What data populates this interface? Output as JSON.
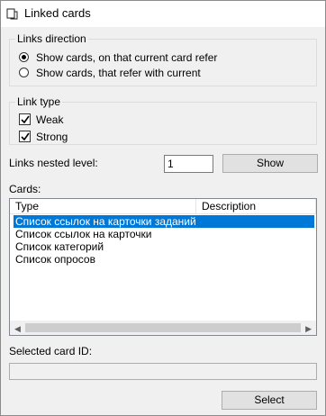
{
  "window": {
    "title": "Linked cards",
    "icon": "linked-cards-icon"
  },
  "links_direction": {
    "legend": "Links direction",
    "options": [
      {
        "label": "Show cards, on that current card refer",
        "selected": true
      },
      {
        "label": "Show cards, that refer with current",
        "selected": false
      }
    ]
  },
  "link_type": {
    "legend": "Link type",
    "options": [
      {
        "label": "Weak",
        "checked": true
      },
      {
        "label": "Strong",
        "checked": true
      }
    ]
  },
  "nested_level": {
    "label": "Links nested level:",
    "value": "1"
  },
  "show_button": {
    "label": "Show"
  },
  "cards": {
    "label": "Cards:",
    "columns": [
      "Type",
      "Description"
    ],
    "rows": [
      {
        "type": "Список ссылок на карточки заданий",
        "selected": true
      },
      {
        "type": "Список ссылок на карточки",
        "selected": false
      },
      {
        "type": "Список категорий",
        "selected": false
      },
      {
        "type": "Список опросов",
        "selected": false
      }
    ]
  },
  "selected_card": {
    "label": "Selected card ID:",
    "value": ""
  },
  "select_button": {
    "label": "Select"
  },
  "colors": {
    "selection": "#0078d7",
    "background": "#f0f0f0",
    "titlebar": "#ffffff"
  }
}
